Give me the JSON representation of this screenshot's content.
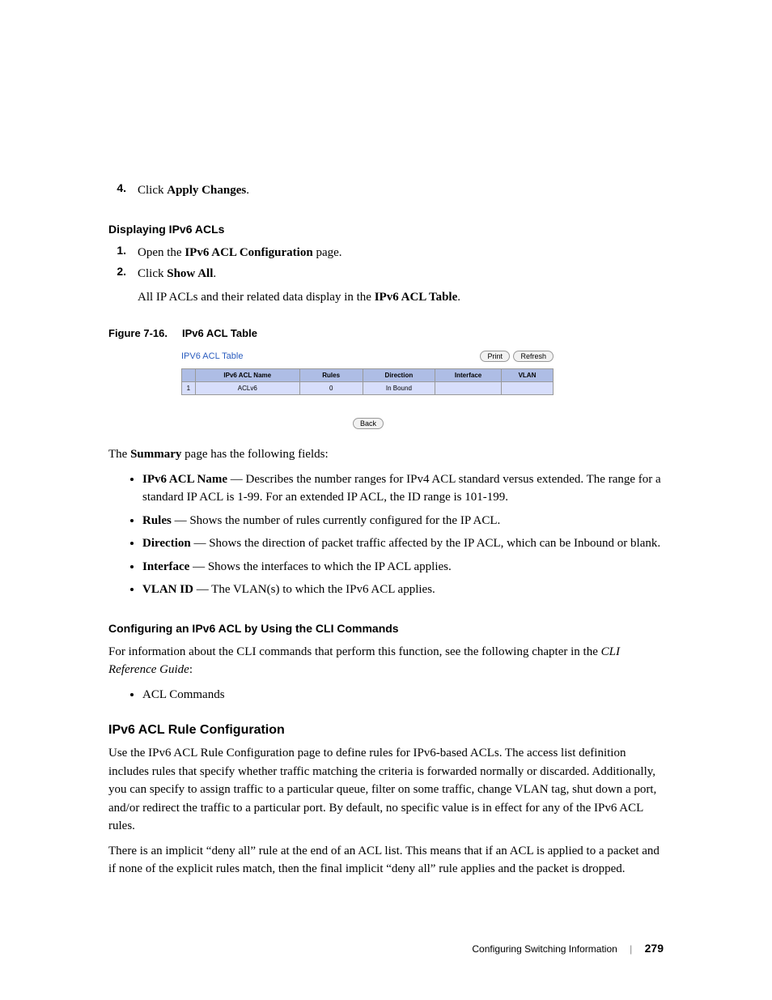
{
  "step4": {
    "num": "4.",
    "prefix": "Click ",
    "bold": "Apply Changes",
    "suffix": "."
  },
  "display_heading": "Displaying IPv6 ACLs",
  "step1": {
    "num": "1.",
    "prefix": "Open the ",
    "bold": "IPv6 ACL Configuration",
    "suffix": " page."
  },
  "step2": {
    "num": "2.",
    "prefix": "Click ",
    "bold": "Show All",
    "suffix": ".",
    "sub_prefix": "All IP ACLs and their related data display in the ",
    "sub_bold": "IPv6 ACL Table",
    "sub_suffix": "."
  },
  "fig": {
    "label": "Figure 7-16.",
    "title": "IPv6 ACL Table"
  },
  "chart_data": {
    "type": "table",
    "title": "IPV6 ACL Table",
    "buttons": {
      "print": "Print",
      "refresh": "Refresh",
      "back": "Back"
    },
    "columns": [
      "",
      "IPv6 ACL Name",
      "Rules",
      "Direction",
      "Interface",
      "VLAN"
    ],
    "rows": [
      {
        "idx": "1",
        "name": "ACLv6",
        "rules": "0",
        "direction": "In Bound",
        "interface": "",
        "vlan": ""
      }
    ]
  },
  "summary_intro": {
    "prefix": "The ",
    "bold": "Summary",
    "suffix": " page has the following fields:"
  },
  "fields": [
    {
      "name": "IPv6 ACL Name",
      "desc": " — Describes the number ranges for IPv4 ACL standard versus extended. The range for a standard IP ACL is 1-99. For an extended IP ACL, the ID range is 101-199."
    },
    {
      "name": "Rules",
      "desc": " — Shows the number of rules currently configured for the IP ACL."
    },
    {
      "name": "Direction",
      "desc": " — Shows the direction of packet traffic affected by the IP ACL, which can be Inbound or blank."
    },
    {
      "name": "Interface",
      "desc": " — Shows the interfaces to which the IP ACL applies."
    },
    {
      "name": "VLAN ID",
      "desc": " — The VLAN(s) to which the IPv6 ACL applies."
    }
  ],
  "cli_heading": "Configuring an IPv6 ACL by Using the CLI Commands",
  "cli_text": {
    "prefix": "For information about the CLI commands that perform this function, see the following chapter in the ",
    "italic": "CLI Reference Guide",
    "suffix": ":"
  },
  "cli_bullet": "ACL Commands",
  "rule_heading": "IPv6 ACL Rule Configuration",
  "rule_p1": "Use the IPv6 ACL Rule Configuration page to define rules for IPv6-based ACLs. The access list definition includes rules that specify whether traffic matching the criteria is forwarded normally or discarded. Additionally, you can specify to assign traffic to a particular queue, filter on some traffic, change VLAN tag, shut down a port, and/or redirect the traffic to a particular port. By default, no specific value is in effect for any of the IPv6 ACL rules.",
  "rule_p2": "There is an implicit “deny all” rule at the end of an ACL list. This means that if an ACL is applied to a packet and if none of the explicit rules match, then the final implicit “deny all” rule applies and the packet is dropped.",
  "footer": {
    "section": "Configuring Switching Information",
    "page": "279"
  }
}
